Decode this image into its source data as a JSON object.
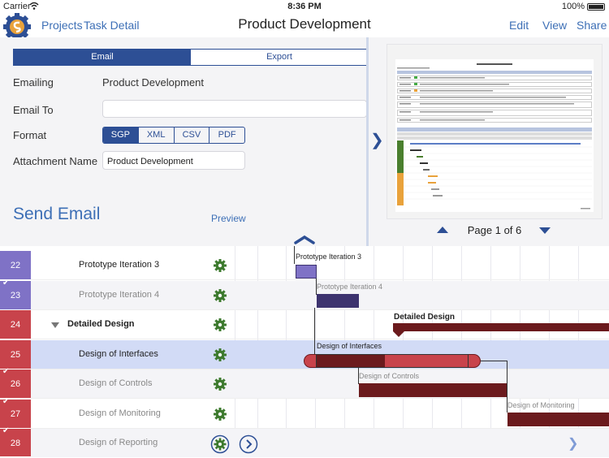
{
  "status_bar": {
    "carrier": "Carrier",
    "time": "8:36 PM",
    "battery": "100%"
  },
  "nav": {
    "projects": "Projects",
    "task_detail": "Task Detail",
    "title": "Product Development",
    "edit": "Edit",
    "view": "View",
    "share": "Share"
  },
  "tabs": [
    "Email",
    "Export"
  ],
  "form": {
    "emailing_label": "Emailing",
    "emailing_value": "Product Development",
    "email_to_label": "Email To",
    "email_to_value": "",
    "format_label": "Format",
    "formats": [
      "SGP",
      "XML",
      "CSV",
      "PDF"
    ],
    "selected_format": "SGP",
    "attachment_label": "Attachment Name",
    "attachment_value": "Product Development",
    "send_label": "Send Email",
    "preview_label": "Preview"
  },
  "pager": {
    "text": "Page 1 of 6"
  },
  "tasks": [
    {
      "num": "22",
      "name": "Prototype Iteration 3",
      "done": false,
      "color": "#7f72c6",
      "bold": false,
      "muted": false
    },
    {
      "num": "23",
      "name": "Prototype Iteration 4",
      "done": true,
      "color": "#7f72c6",
      "bold": false,
      "muted": true
    },
    {
      "num": "24",
      "name": "Detailed Design",
      "done": false,
      "color": "#c8434b",
      "bold": true,
      "muted": false
    },
    {
      "num": "25",
      "name": "Design of Interfaces",
      "done": false,
      "color": "#c8434b",
      "bold": false,
      "muted": false
    },
    {
      "num": "26",
      "name": "Design of Controls",
      "done": true,
      "color": "#c8434b",
      "bold": false,
      "muted": true
    },
    {
      "num": "27",
      "name": "Design of Monitoring",
      "done": true,
      "color": "#c8434b",
      "bold": false,
      "muted": true
    },
    {
      "num": "28",
      "name": "Design of Reporting",
      "done": true,
      "color": "#c8434b",
      "bold": false,
      "muted": true
    }
  ],
  "gantt_labels": {
    "prototype_3": "Prototype Iteration 3",
    "prototype_4": "Prototype Iteration 4",
    "detailed_design": "Detailed Design",
    "design_interfaces": "Design of Interfaces",
    "design_controls": "Design of Controls",
    "design_monitoring": "Design of Monitoring"
  },
  "colors": {
    "accent": "#2d4f95",
    "link": "#3d6fb6",
    "purple": "#7f72c6",
    "dark_purple": "#3d336f",
    "red": "#c8434b",
    "dark_red": "#6b1a1d",
    "gear": "#3d7a2e"
  }
}
